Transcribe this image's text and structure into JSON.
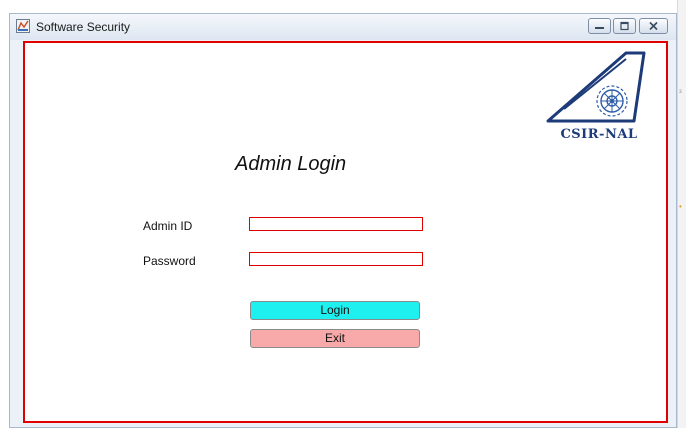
{
  "window": {
    "title": "Software Security"
  },
  "logo": {
    "text": "CSIR-NAL"
  },
  "form": {
    "heading": "Admin Login",
    "admin_id_label": "Admin ID",
    "admin_id_value": "",
    "password_label": "Password",
    "password_value": "",
    "login_label": "Login",
    "exit_label": "Exit"
  },
  "colors": {
    "form_border": "#e00000",
    "login_button": "#1ef0f0",
    "exit_button": "#f8aaaa",
    "logo_blue": "#1c3b78"
  },
  "icons": [
    "app-icon",
    "minimize-icon",
    "maximize-icon",
    "close-icon",
    "csir-nal-logo"
  ]
}
